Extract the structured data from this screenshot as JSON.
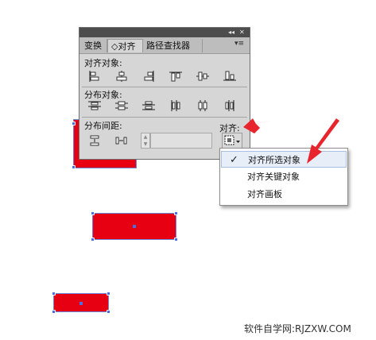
{
  "panel": {
    "titlebar": {
      "collapse_glyph": "◂◂",
      "close_glyph": "✕"
    },
    "tabs": [
      {
        "label": "变换",
        "active": false
      },
      {
        "label": "◇对齐",
        "active": true
      },
      {
        "label": "路径查找器",
        "active": false
      }
    ],
    "menu_glyph": "▾≡",
    "align_objects_label": "对齐对象:",
    "distribute_objects_label": "分布对象:",
    "distribute_spacing_label": "分布间距:",
    "align_to_label": "对齐:",
    "spacing_value": "",
    "align_icons": [
      "align-left-icon",
      "align-horizontal-center-icon",
      "align-right-icon",
      "align-top-icon",
      "align-vertical-center-icon",
      "align-bottom-icon"
    ],
    "distribute_icons": [
      "distribute-top-icon",
      "distribute-vertical-center-icon",
      "distribute-bottom-icon",
      "distribute-left-icon",
      "distribute-horizontal-center-icon",
      "distribute-right-icon"
    ],
    "spacing_icons": [
      "distribute-vertical-space-icon",
      "distribute-horizontal-space-icon"
    ]
  },
  "dropdown": {
    "items": [
      {
        "label": "对齐所选对象",
        "checked": true
      },
      {
        "label": "对齐关键对象",
        "checked": false
      },
      {
        "label": "对齐画板",
        "checked": false
      }
    ],
    "check_glyph": "✓"
  },
  "watermark": "软件自学网:RJZXW.COM",
  "colors": {
    "shape_fill": "#e60012",
    "selection": "#4a6fe3",
    "arrow": "#e8242c"
  }
}
